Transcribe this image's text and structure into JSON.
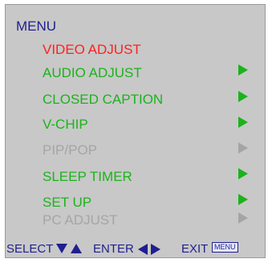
{
  "menu": {
    "title": "MENU",
    "items": [
      {
        "label": "VIDEO ADJUST",
        "color": "#ff2020",
        "has_arrow": false,
        "enabled": true,
        "selected": true
      },
      {
        "label": "AUDIO  ADJUST",
        "color": "#1bb31b",
        "has_arrow": true,
        "enabled": true
      },
      {
        "label": "CLOSED CAPTION",
        "color": "#1bb31b",
        "has_arrow": true,
        "enabled": true
      },
      {
        "label": "V-CHIP",
        "color": "#1bb31b",
        "has_arrow": true,
        "enabled": true
      },
      {
        "label": "PIP/POP",
        "color": "#a5a5a5",
        "has_arrow": true,
        "enabled": false
      },
      {
        "label": "SLEEP  TIMER",
        "color": "#1bb31b",
        "has_arrow": true,
        "enabled": true
      },
      {
        "label": "SET  UP",
        "color": "#1bb31b",
        "has_arrow": true,
        "enabled": true
      },
      {
        "label": "PC  ADJUST",
        "color": "#a5a5a5",
        "has_arrow": true,
        "enabled": false
      }
    ]
  },
  "footer": {
    "select_label": "SELECT",
    "enter_label": "ENTER",
    "exit_label": "EXIT",
    "menu_key_label": "MENU"
  },
  "colors": {
    "panel_background": "#c8c8c8",
    "title_color": "#1f1f8f",
    "active_item": "#ff2020",
    "enabled_item": "#1bb31b",
    "disabled_item": "#a5a5a5"
  }
}
